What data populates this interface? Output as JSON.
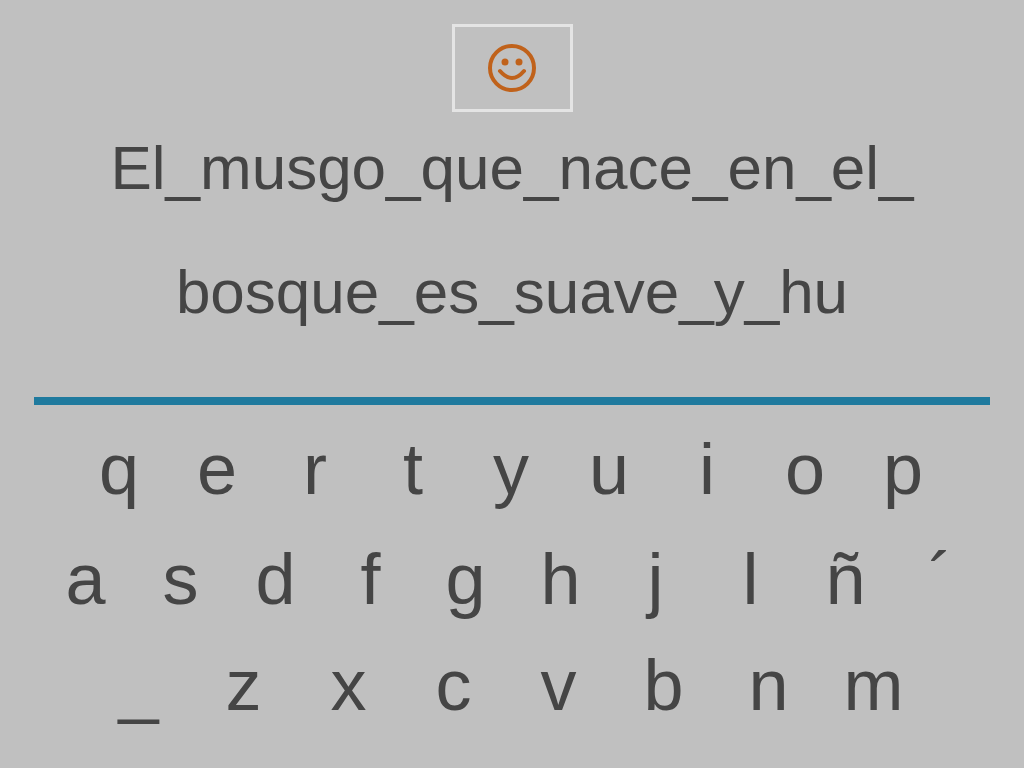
{
  "sentence_lines": [
    "El_musgo_que_nace_en_el_",
    "bosque_es_suave_y_hu"
  ],
  "keyboard_rows": [
    [
      "q",
      "e",
      "r",
      "t",
      "y",
      "u",
      "i",
      "o",
      "p"
    ],
    [
      "a",
      "s",
      "d",
      "f",
      "g",
      "h",
      "j",
      "l",
      "ñ",
      "´"
    ],
    [
      "_",
      "z",
      "x",
      "c",
      "v",
      "b",
      "n",
      "m"
    ]
  ]
}
